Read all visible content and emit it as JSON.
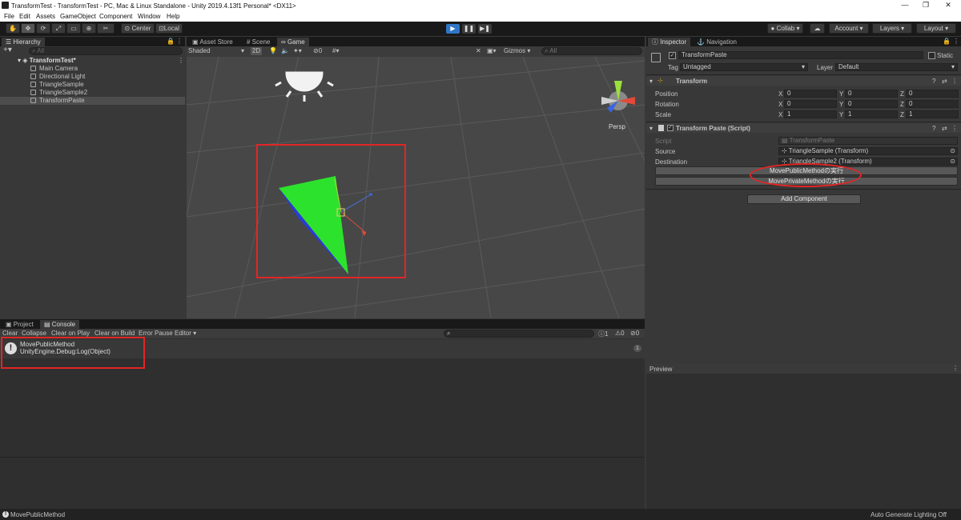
{
  "window": {
    "title": "TransformTest - TransformTest - PC, Mac & Linux Standalone - Unity 2019.4.13f1 Personal* <DX11>"
  },
  "menu": [
    "File",
    "Edit",
    "Assets",
    "GameObject",
    "Component",
    "Window",
    "Help"
  ],
  "toolbar": {
    "pivot": "Center",
    "space": "Local",
    "collab": "Collab",
    "account": "Account",
    "layers": "Layers",
    "layout": "Layout"
  },
  "hierarchy": {
    "tab": "Hierarchy",
    "search_placeholder": "All",
    "scene": "TransformTest*",
    "items": [
      "Main Camera",
      "Directional Light",
      "TriangleSample",
      "TriangleSample2",
      "TransformPaste"
    ]
  },
  "scene": {
    "tabs": [
      "Asset Store",
      "Scene",
      "Game"
    ],
    "shading": "Shaded",
    "mode": "2D",
    "hidden_count": "0",
    "gizmos": "Gizmos",
    "search_placeholder": "All",
    "persp": "Persp"
  },
  "project_console": {
    "tabs": [
      "Project",
      "Console"
    ],
    "buttons": [
      "Clear",
      "Collapse",
      "Clear on Play",
      "Clear on Build",
      "Error Pause",
      "Editor"
    ],
    "counts": {
      "info": "1",
      "warn": "0",
      "err": "0"
    },
    "log": {
      "line1": "MovePublicMethod",
      "line2": "UnityEngine.Debug:Log(Object)",
      "count": "1"
    }
  },
  "inspector": {
    "tabs": [
      "Inspector",
      "Navigation"
    ],
    "object_name": "TransformPaste",
    "static_label": "Static",
    "tag_label": "Tag",
    "tag_value": "Untagged",
    "layer_label": "Layer",
    "layer_value": "Default",
    "transform": {
      "title": "Transform",
      "rows": [
        {
          "label": "Position",
          "x": "0",
          "y": "0",
          "z": "0"
        },
        {
          "label": "Rotation",
          "x": "0",
          "y": "0",
          "z": "0"
        },
        {
          "label": "Scale",
          "x": "1",
          "y": "1",
          "z": "1"
        }
      ]
    },
    "script_comp": {
      "title": "Transform Paste (Script)",
      "script_label": "Script",
      "script_value": "TransformPaste",
      "source_label": "Source",
      "source_value": "TriangleSample (Transform)",
      "dest_label": "Destination",
      "dest_value": "TriangleSample2 (Transform)",
      "btn1": "MovePublicMethodの実行",
      "btn2": "MovePrivateMethodの実行"
    },
    "add_component": "Add Component",
    "preview": "Preview"
  },
  "status": {
    "message": "MovePublicMethod",
    "right": "Auto Generate Lighting Off"
  },
  "colors": {
    "accent": "#2f77c6",
    "annotation": "#e32525"
  }
}
